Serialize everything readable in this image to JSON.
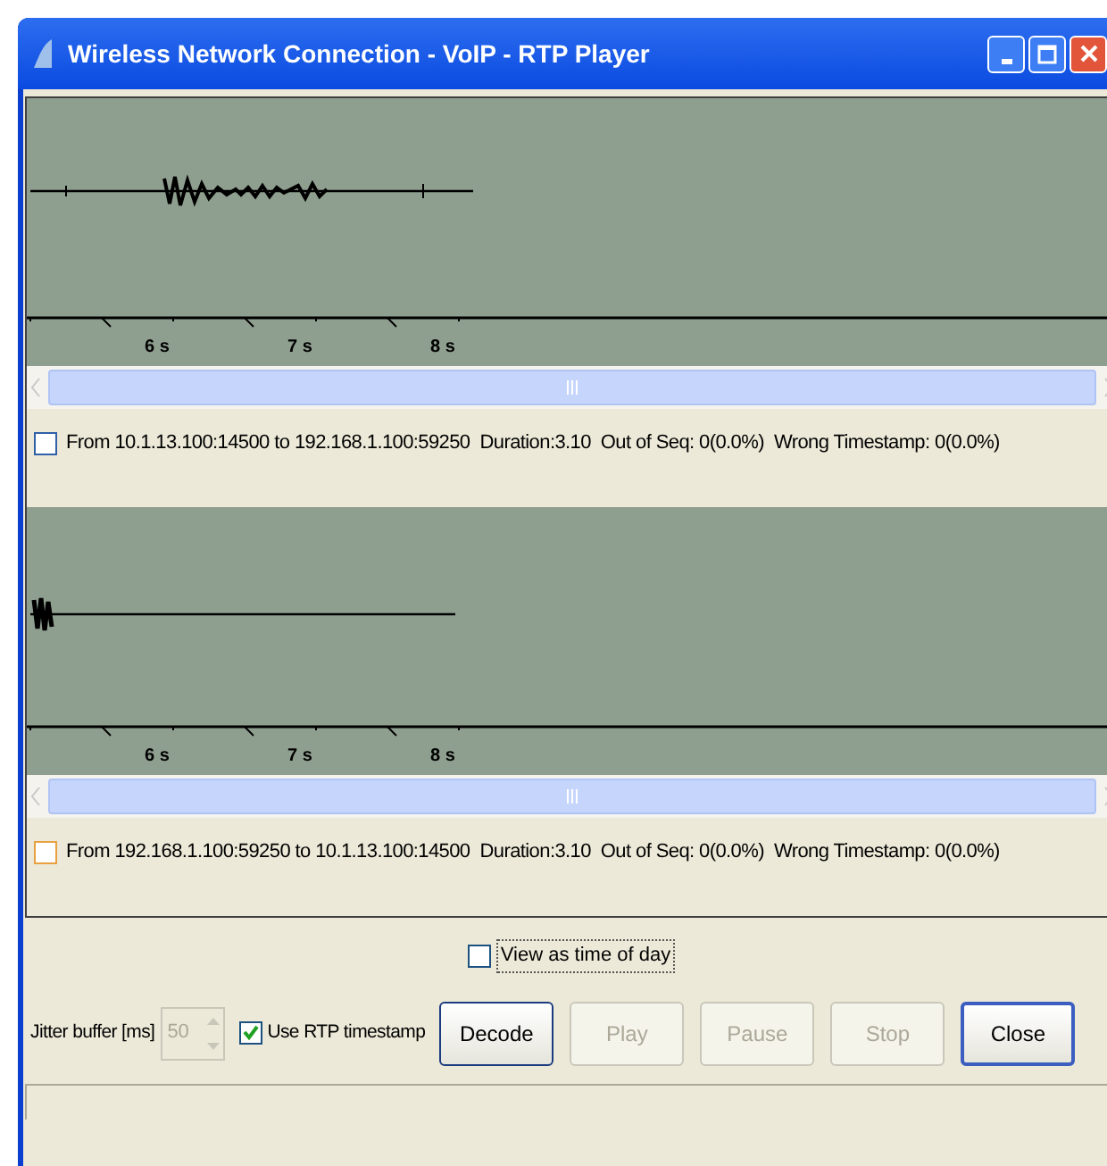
{
  "window": {
    "title": "Wireless Network Connection - VoIP - RTP Player"
  },
  "streams": [
    {
      "ticks": [
        "6 s",
        "7 s",
        "8 s"
      ],
      "info": "From 10.1.13.100:14500 to 192.168.1.100:59250  Duration:3.10  Out of Seq: 0(0.0%)  Wrong Timestamp: 0(0.0%)",
      "checked": false,
      "color": "#2f5fa8"
    },
    {
      "ticks": [
        "6 s",
        "7 s",
        "8 s"
      ],
      "info": "From 192.168.1.100:59250 to 10.1.13.100:14500  Duration:3.10  Out of Seq: 0(0.0%)  Wrong Timestamp: 0(0.0%)",
      "checked": false,
      "color": "#e8a040"
    }
  ],
  "view_time_of_day": {
    "label": "View as time of day",
    "checked": false
  },
  "jitter": {
    "label": "Jitter buffer [ms]",
    "value": "50",
    "disabled": true
  },
  "use_rtp": {
    "label": "Use RTP timestamp",
    "checked": true
  },
  "buttons": [
    {
      "label": "Decode",
      "disabled": false,
      "default": false
    },
    {
      "label": "Play",
      "disabled": true,
      "default": false
    },
    {
      "label": "Pause",
      "disabled": true,
      "default": false
    },
    {
      "label": "Stop",
      "disabled": true,
      "default": false
    },
    {
      "label": "Close",
      "disabled": false,
      "default": true
    }
  ]
}
